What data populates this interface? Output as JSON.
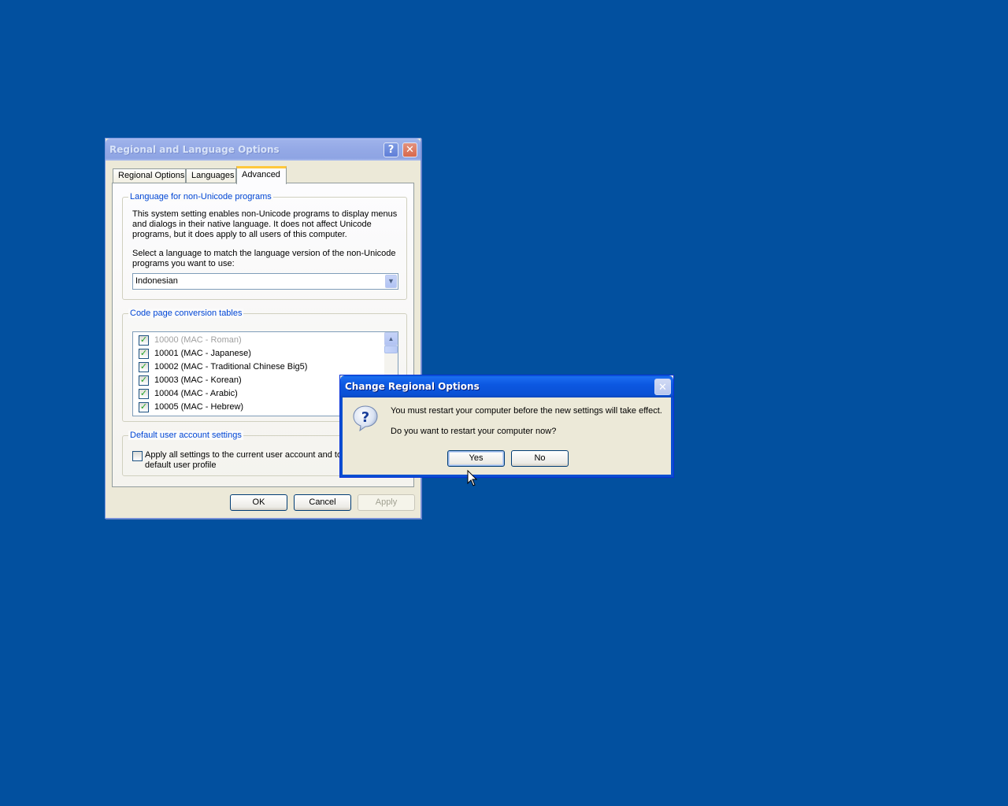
{
  "main_window": {
    "title": "Regional and Language Options",
    "help_glyph": "?",
    "close_glyph": "✕",
    "tabs": [
      {
        "label": "Regional Options"
      },
      {
        "label": "Languages"
      },
      {
        "label": "Advanced"
      }
    ],
    "active_tab": "Advanced",
    "non_unicode_group": {
      "label": "Language for non-Unicode programs",
      "description": "This system setting enables non-Unicode programs to display menus and dialogs in their native language. It does not affect Unicode programs, but it does apply to all users of this computer.",
      "select_prompt": "Select a language to match the language version of the non-Unicode programs you want to use:",
      "selected_language": "Indonesian"
    },
    "code_page_group": {
      "label": "Code page conversion tables",
      "items": [
        {
          "label": "10000 (MAC - Roman)",
          "checked": true,
          "disabled": true
        },
        {
          "label": "10001 (MAC - Japanese)",
          "checked": true,
          "disabled": false
        },
        {
          "label": "10002 (MAC - Traditional Chinese Big5)",
          "checked": true,
          "disabled": false
        },
        {
          "label": "10003 (MAC - Korean)",
          "checked": true,
          "disabled": false
        },
        {
          "label": "10004 (MAC - Arabic)",
          "checked": true,
          "disabled": false
        },
        {
          "label": "10005 (MAC - Hebrew)",
          "checked": true,
          "disabled": false
        }
      ]
    },
    "default_user_group": {
      "label": "Default user account settings",
      "checkbox_label": "Apply all settings to the current user account and to the default user profile",
      "checked": false
    },
    "buttons": {
      "ok": "OK",
      "cancel": "Cancel",
      "apply": "Apply"
    }
  },
  "dialog": {
    "title": "Change Regional Options",
    "close_glyph": "✕",
    "message_line1": "You must restart your computer before the new settings will take effect.",
    "message_line2": "Do you want to restart your computer now?",
    "buttons": {
      "yes": "Yes",
      "no": "No"
    }
  },
  "colors": {
    "desktop": "#02509f",
    "dialog_titlebar": "#0a50d4",
    "group_label": "#0046d5"
  }
}
